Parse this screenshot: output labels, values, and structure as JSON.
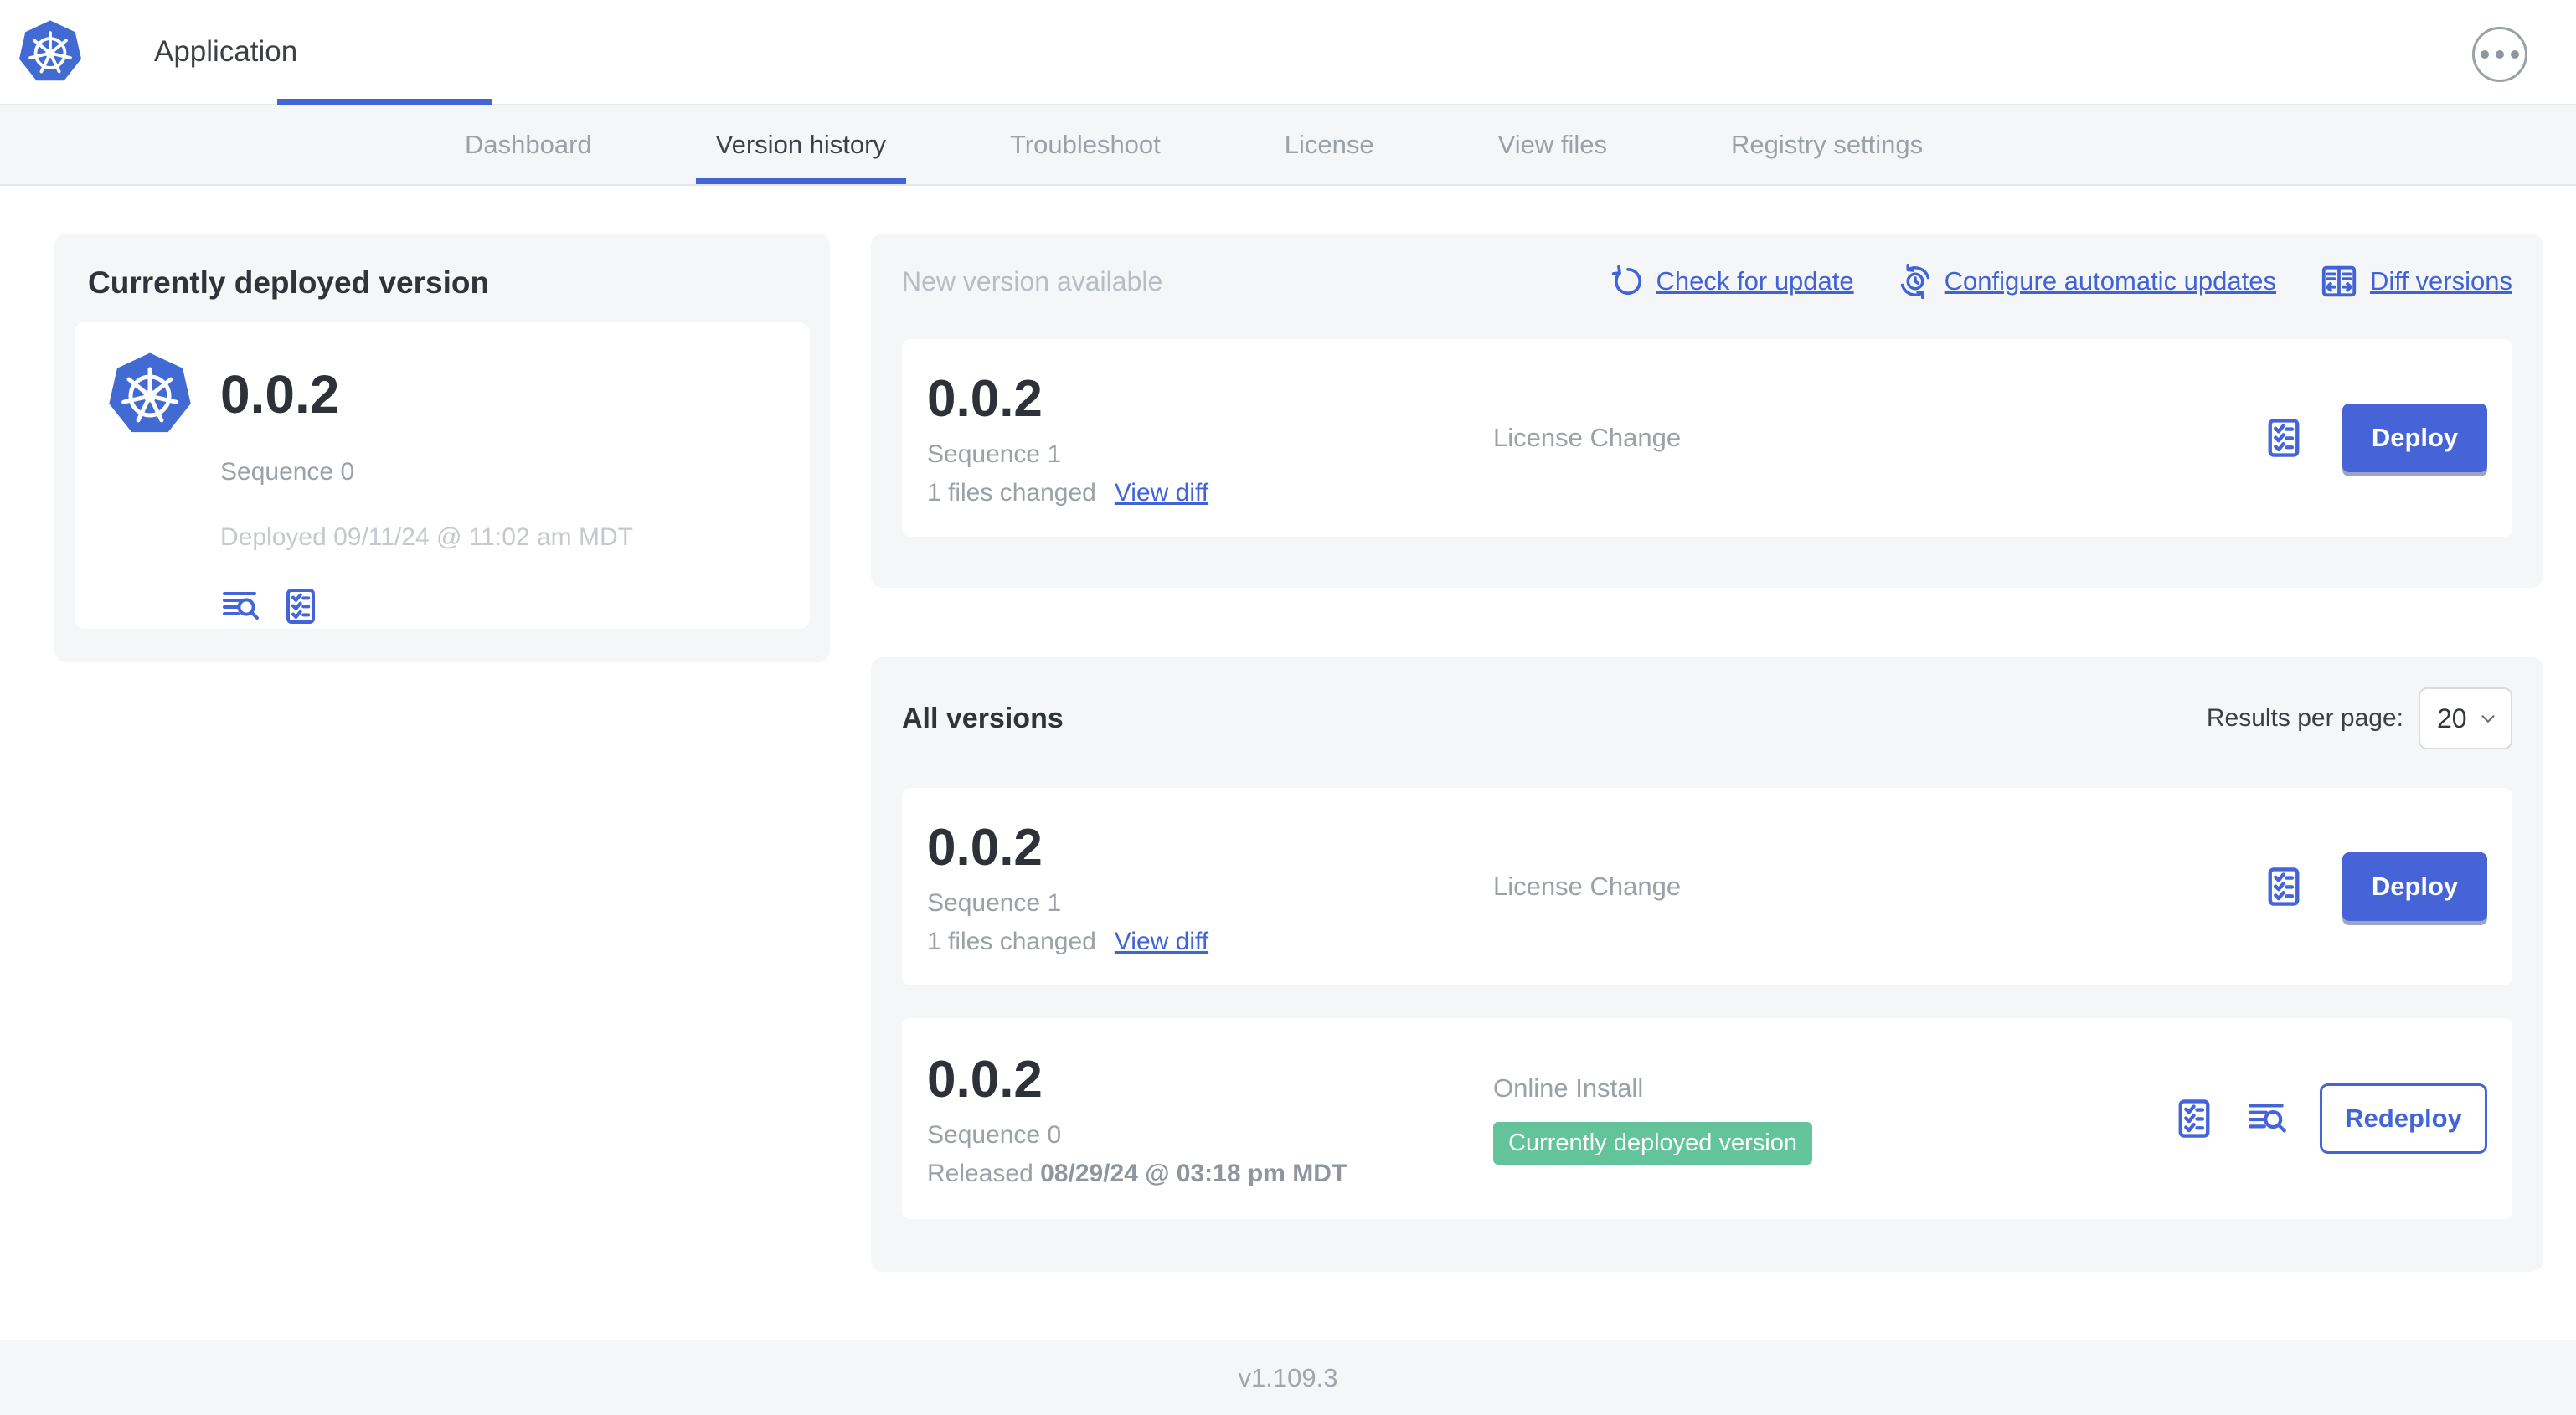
{
  "colors": {
    "accent_blue": "#4465d9",
    "button_blue": "#4664d7",
    "badge_green": "#63c49c",
    "k8s_logo_blue": "#416bd2",
    "panel_gray": "#f5f6f8"
  },
  "icons": {
    "logo": "kubernetes-wheel",
    "menu": "ellipsis-circle",
    "refresh": "circular-arrow",
    "auto_update": "clock-sync-arrows",
    "diff": "split-columns-arrows",
    "logs": "lines-magnifier",
    "checklist": "clipboard-checks",
    "chevron": "chevron-down"
  },
  "header": {
    "title": "Application"
  },
  "nav": {
    "active_tab": "Version history",
    "tabs": [
      {
        "label": "Dashboard"
      },
      {
        "label": "Version history"
      },
      {
        "label": "Troubleshoot"
      },
      {
        "label": "License"
      },
      {
        "label": "View files"
      },
      {
        "label": "Registry settings"
      }
    ]
  },
  "deployed_card": {
    "title": "Currently deployed version",
    "version": "0.0.2",
    "sequence": "Sequence 0",
    "deployed": "Deployed 09/11/24 @ 11:02 am MDT"
  },
  "new_version": {
    "heading": "New version available",
    "links": [
      {
        "label": "Check for update"
      },
      {
        "label": "Configure automatic updates"
      },
      {
        "label": "Diff versions"
      }
    ],
    "card": {
      "version": "0.0.2",
      "sequence": "Sequence 1",
      "files_changed": "1 files changed",
      "view_diff_label": "View diff",
      "source": "License Change",
      "action_label": "Deploy"
    }
  },
  "all_versions": {
    "heading": "All versions",
    "results_per_page_label": "Results per page:",
    "results_per_page_value": "20",
    "rows": [
      {
        "version": "0.0.2",
        "sequence": "Sequence 1",
        "files_changed": "1 files changed",
        "view_diff_label": "View diff",
        "source": "License Change",
        "action_label": "Deploy"
      },
      {
        "version": "0.0.2",
        "sequence": "Sequence 0",
        "released_label": "Released",
        "released_date": "08/29/24 @ 03:18 pm MDT",
        "source": "Online Install",
        "badge": "Currently deployed version",
        "action_label": "Redeploy"
      }
    ]
  },
  "footer": {
    "app_version": "v1.109.3"
  }
}
